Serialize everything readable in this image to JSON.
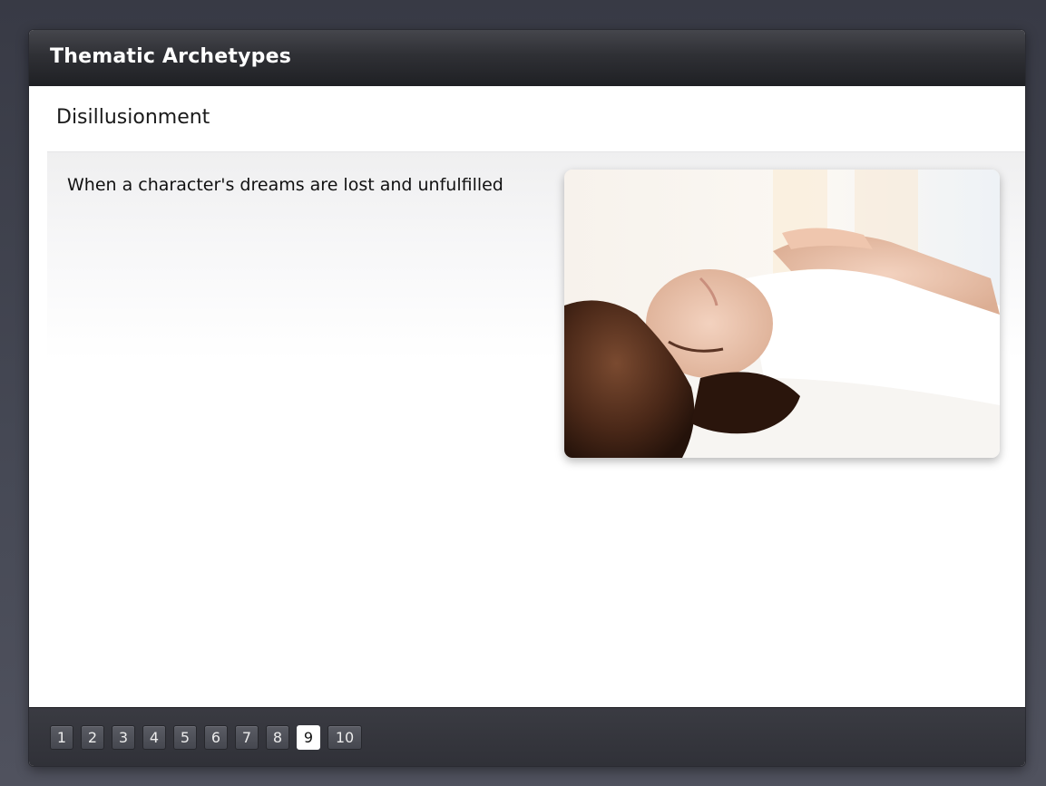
{
  "window": {
    "title": "Thematic Archetypes"
  },
  "slide": {
    "title": "Disillusionment",
    "body": "When a character's dreams are lost and unfulfilled",
    "image": "woman-lying-in-bed"
  },
  "pagination": {
    "pages": [
      "1",
      "2",
      "3",
      "4",
      "5",
      "6",
      "7",
      "8",
      "9",
      "10"
    ],
    "current": "9"
  },
  "colors": {
    "titlebar": "#2f3035",
    "background": "#464955",
    "active_page": "#ffffff"
  }
}
